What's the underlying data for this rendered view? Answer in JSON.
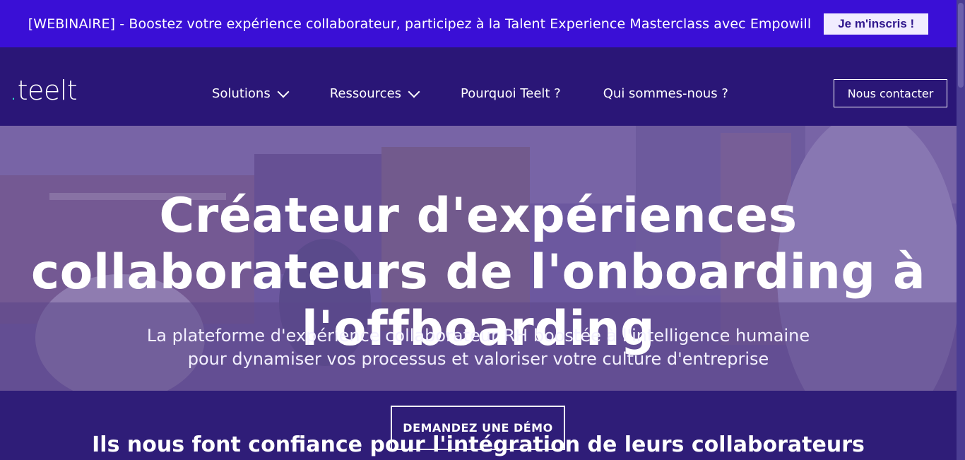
{
  "banner": {
    "text": "[WEBINAIRE] - Boostez votre expérience collaborateur, participez à la Talent Experience Masterclass avec Empowill",
    "button_label": "Je m'inscris !"
  },
  "nav": {
    "logo_dot": ".",
    "logo_text": "teelt",
    "items": [
      {
        "label": "Solutions",
        "has_dropdown": true
      },
      {
        "label": "Ressources",
        "has_dropdown": true
      },
      {
        "label": "Pourquoi Teelt ?",
        "has_dropdown": false
      },
      {
        "label": "Qui sommes-nous ?",
        "has_dropdown": false
      }
    ],
    "contact_label": "Nous contacter"
  },
  "hero": {
    "title": "Créateur d'expériences collaborateurs de l'onboarding à l'offboarding",
    "subtitle_line1": "La plateforme d'expérience collaborateur RH boostée à l'intelligence humaine",
    "subtitle_line2": "pour dynamiser vos processus et valoriser votre culture d'entreprise"
  },
  "cta": {
    "demo_label": "DEMANDEZ UNE DÉMO"
  },
  "trust": {
    "title": "Ils nous font confiance pour l'intégration de leurs collaborateurs"
  },
  "colors": {
    "banner_bg": "#3a0fd6",
    "nav_bg": "#2a1677",
    "page_bg": "#2f1d78",
    "logo_accent": "#2fe3c9"
  },
  "icons": {
    "dropdown": "chevron-down-icon"
  }
}
